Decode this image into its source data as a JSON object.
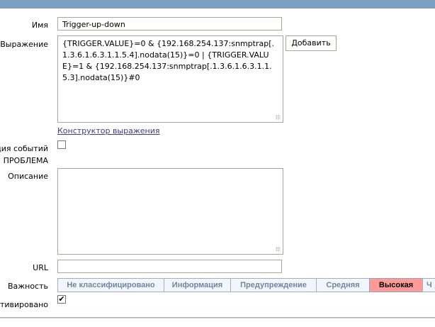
{
  "form": {
    "name_label": "Имя",
    "name_value": "Trigger-up-down",
    "expression_label": "Выражение",
    "expression_value": "{TRIGGER.VALUE}=0 & {192.168.254.137:snmptrap[.1.3.6.1.6.3.1.1.5.4].nodata(15)}=0 | {TRIGGER.VALUE}=1 & {192.168.254.137:snmptrap[.1.3.6.1.6.3.1.1.5.3].nodata(15)}#0",
    "add_button": "Добавить",
    "constructor_link": "Конструктор выражения",
    "multiple_events_label": "ция событий",
    "problem_label": "ПРОБЛЕМА",
    "multiple_events_checked": false,
    "description_label": "Описание",
    "description_value": "",
    "url_label": "URL",
    "url_value": "",
    "severity_label": "Важность",
    "severity_options": [
      "Не классифицировано",
      "Информация",
      "Предупреждение",
      "Средняя",
      "Высокая",
      "Ч"
    ],
    "severity_selected": "Высокая",
    "enabled_label": "тивировано",
    "enabled_checked": true,
    "check_mark": "✔"
  },
  "colors": {
    "header": "#7a9fc2",
    "selected_severity": "#ff9a96"
  }
}
